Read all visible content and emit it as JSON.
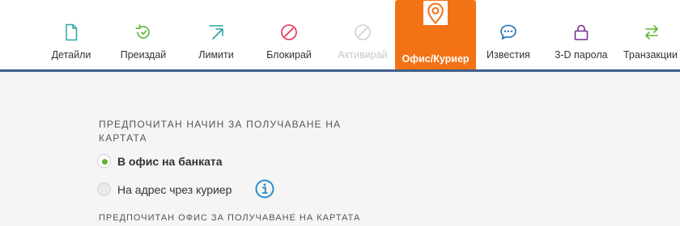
{
  "toolbar": {
    "items": [
      {
        "label": "Детайли",
        "icon": "document-icon",
        "color": "#2aa6a6"
      },
      {
        "label": "Преиздай",
        "icon": "reissue-icon",
        "color": "#5cb531"
      },
      {
        "label": "Лимити",
        "icon": "limits-icon",
        "color": "#2aa6a6"
      },
      {
        "label": "Блокирай",
        "icon": "block-icon",
        "color": "#e5305a"
      },
      {
        "label": "Активирай",
        "icon": "activate-icon",
        "color": "#d0d0d0"
      },
      {
        "label": "Офис/Куриер",
        "icon": "location-pin-icon",
        "color": "#f47216"
      },
      {
        "label": "Известия",
        "icon": "chat-bubble-icon",
        "color": "#1f6fb2"
      },
      {
        "label": "3-D парола",
        "icon": "lock-icon",
        "color": "#7b2d8e"
      },
      {
        "label": "Транзакции",
        "icon": "transfer-arrows-icon",
        "color": "#5cb531"
      }
    ],
    "active_index": 5,
    "active_color": "#f47216",
    "rule_color": "#3e5f8a"
  },
  "delivery": {
    "title": "ПРЕДПОЧИТАН НАЧИН ЗА ПОЛУЧАВАНЕ НА КАРТАТА",
    "options": [
      {
        "label": "В офис на банката",
        "selected": true
      },
      {
        "label": "На адрес чрез куриер",
        "selected": false
      }
    ],
    "radio_color": "#5cb531",
    "info_icon": "info-icon",
    "info_color": "#2a8fc7"
  },
  "office": {
    "title": "ПРЕДПОЧИТАН ОФИС ЗА ПОЛУЧАВАНЕ НА КАРТАТА"
  }
}
